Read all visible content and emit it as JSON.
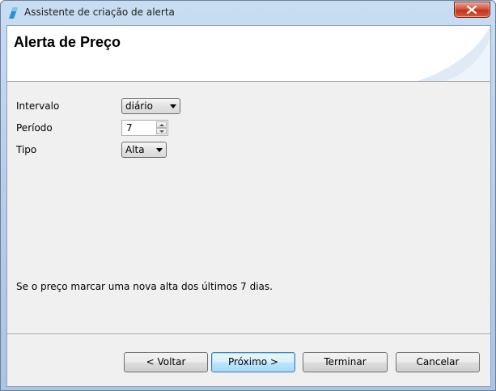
{
  "window": {
    "title": "Assistente de criação de alerta",
    "icon": "wizard-app-icon"
  },
  "header": {
    "title": "Alerta de Preço"
  },
  "form": {
    "interval": {
      "label": "Intervalo",
      "value": "diário"
    },
    "period": {
      "label": "Período",
      "value": "7"
    },
    "type": {
      "label": "Tipo",
      "value": "Alta"
    }
  },
  "description": "Se o preço marcar uma nova alta dos últimos 7 dias.",
  "buttons": {
    "back": "< Voltar",
    "next": "Próximo >",
    "finish": "Terminar",
    "cancel": "Cancelar"
  },
  "colors": {
    "accent": "#3c7fb1",
    "close": "#c0341e"
  }
}
